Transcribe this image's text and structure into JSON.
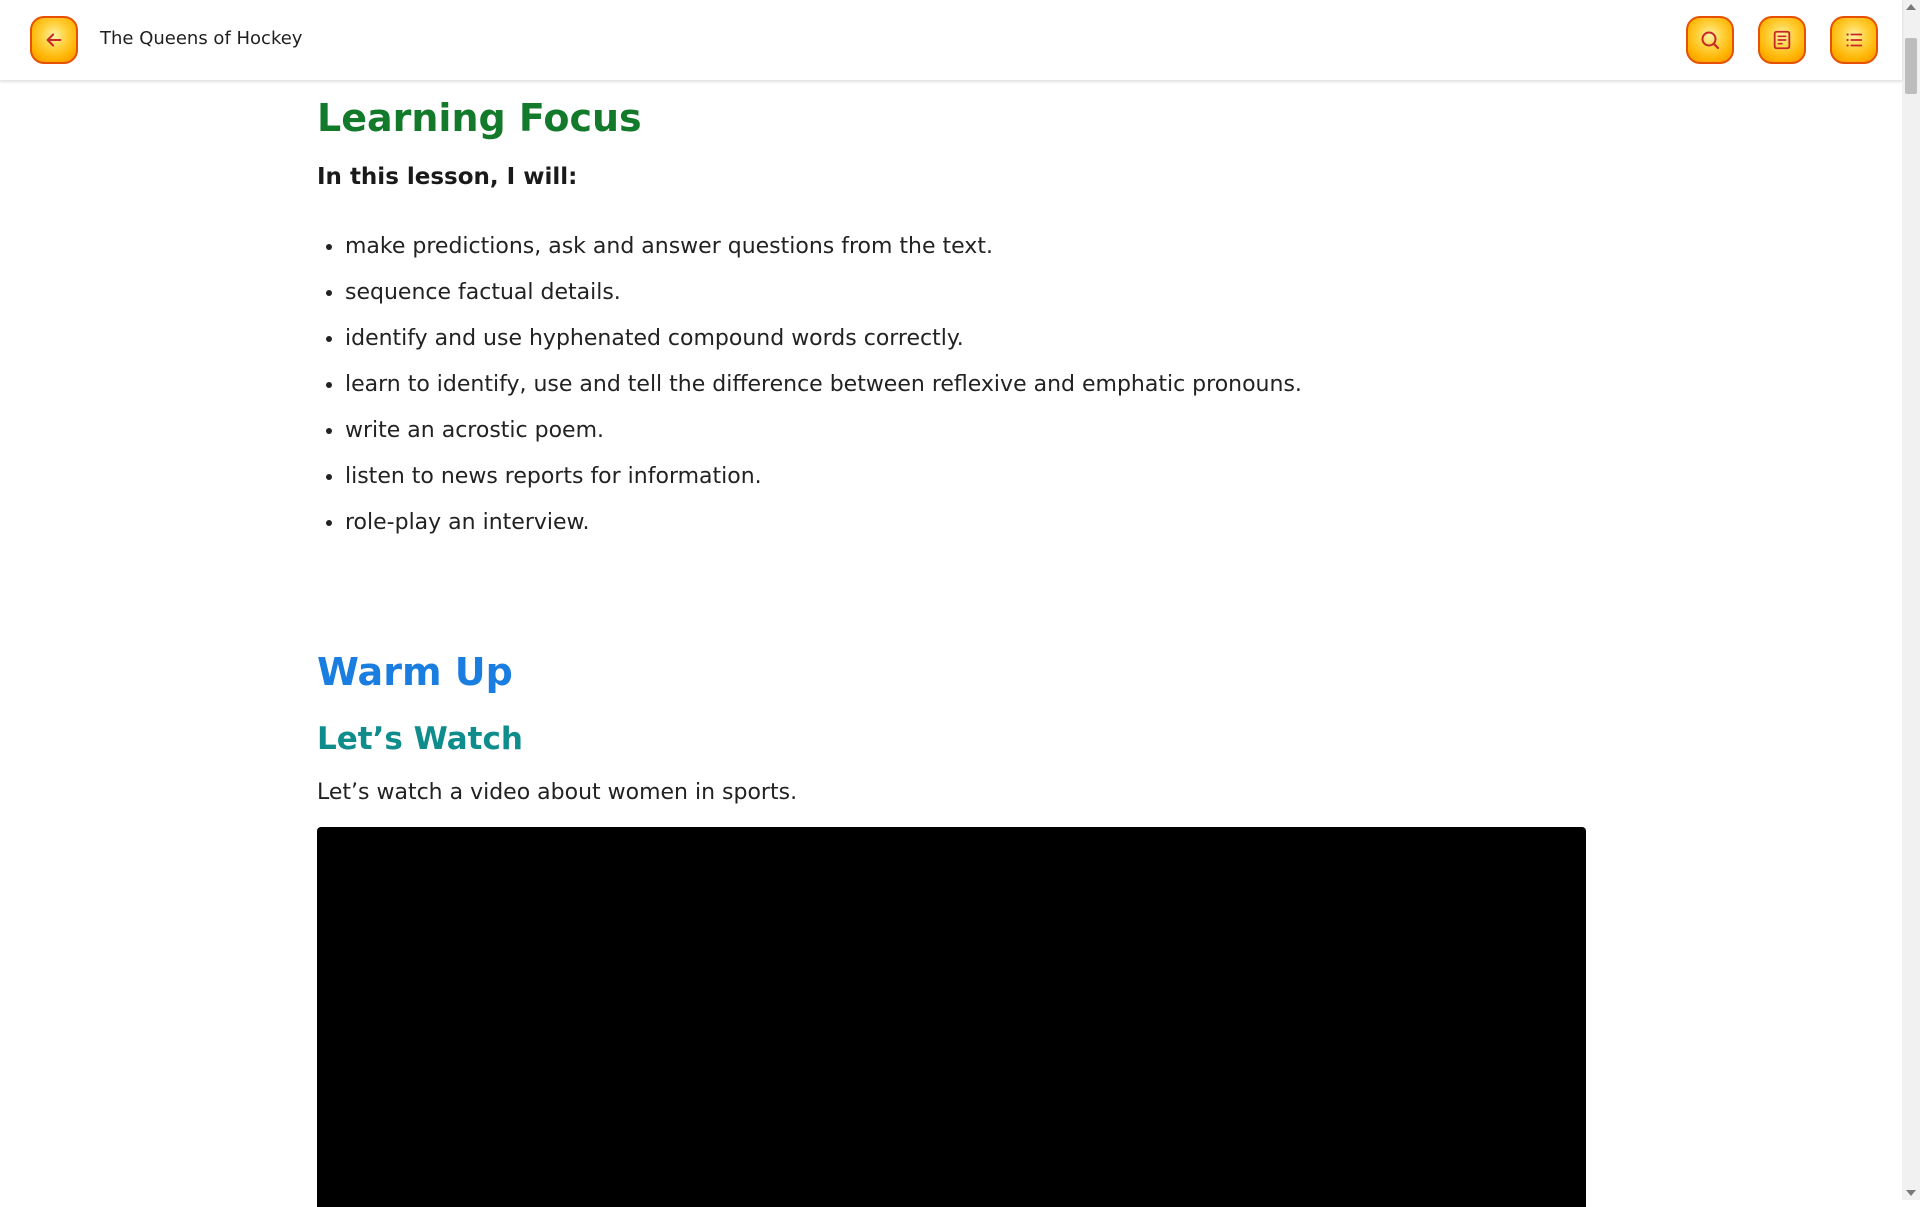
{
  "header": {
    "title": "The Queens of Hockey",
    "back_icon": "arrow-left-icon",
    "search_icon": "search-icon",
    "notes_icon": "notes-icon",
    "toc_icon": "list-icon"
  },
  "colors": {
    "button_fill": "#ffc21a",
    "button_border": "#e65100",
    "learning_focus_heading": "#127a2a",
    "warm_up_heading": "#1a7de0",
    "lets_watch_heading": "#0f8c8c"
  },
  "learning_focus": {
    "heading": "Learning Focus",
    "intro": "In this lesson, I will:",
    "items": [
      "make predictions, ask and answer questions from the text.",
      "sequence factual details.",
      "identify and use hyphenated compound words correctly.",
      "learn to identify, use and tell the difference between reflexive and emphatic pronouns.",
      "write an acrostic poem.",
      "listen to news reports for information.",
      "role-play an interview."
    ]
  },
  "warm_up": {
    "heading": "Warm Up",
    "subheading": "Let’s Watch",
    "text": "Let’s watch a video about women in sports."
  }
}
